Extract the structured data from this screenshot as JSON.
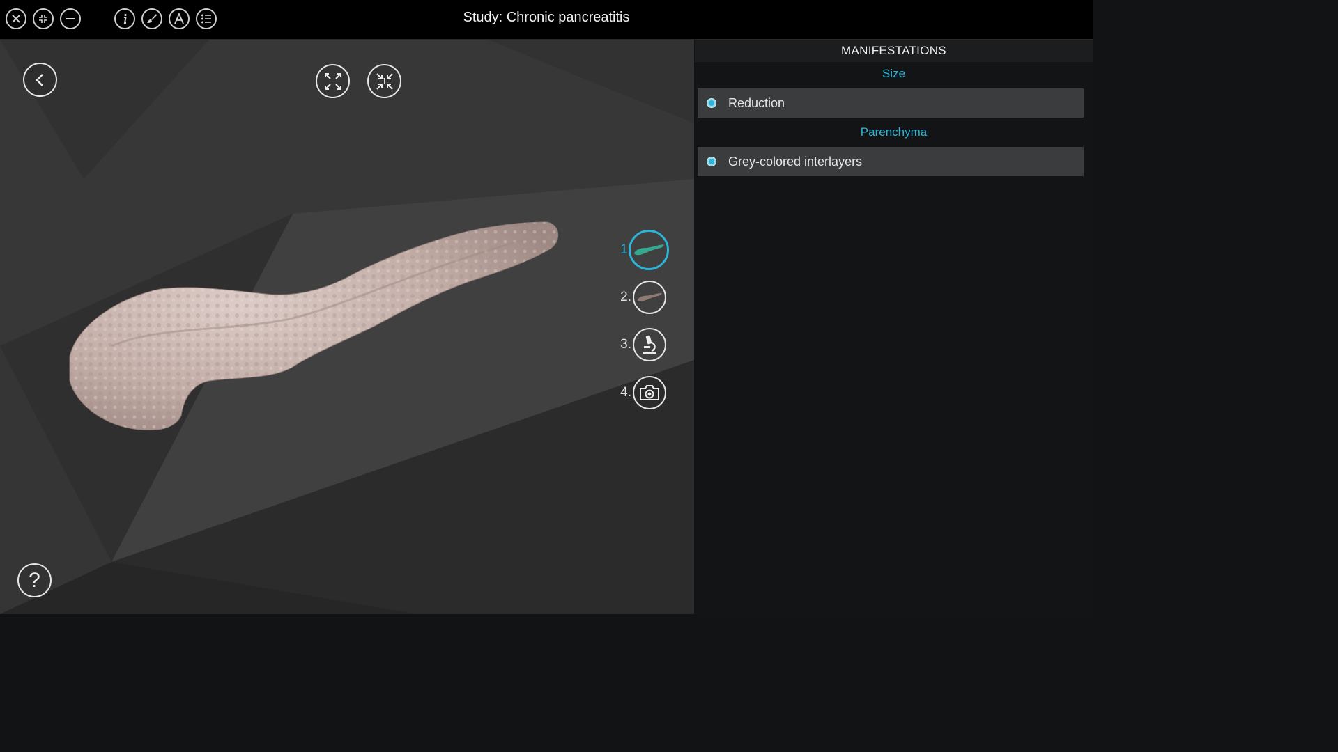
{
  "window": {
    "title": "Study: Chronic pancreatitis"
  },
  "toolbar": {
    "buttons": [
      {
        "name": "close-icon"
      },
      {
        "name": "collapse-icon"
      },
      {
        "name": "minimize-icon"
      },
      {
        "name": "info-icon"
      },
      {
        "name": "paintbrush-icon"
      },
      {
        "name": "font-icon"
      },
      {
        "name": "list-icon"
      }
    ]
  },
  "viewport": {
    "back": "back-arrow-icon",
    "expand": "expand-icon",
    "reset_label": "1",
    "help": "?",
    "steps": [
      {
        "num": "1.",
        "icon": "pancreas-icon",
        "active": true
      },
      {
        "num": "2.",
        "icon": "pancreas-icon",
        "active": false
      },
      {
        "num": "3.",
        "icon": "microscope-icon",
        "active": false
      },
      {
        "num": "4.",
        "icon": "camera-icon",
        "active": false
      }
    ]
  },
  "panel": {
    "header": "MANIFESTATIONS",
    "sections": [
      {
        "title": "Size",
        "items": [
          "Reduction"
        ]
      },
      {
        "title": "Parenchyma",
        "items": [
          "Grey-colored interlayers"
        ]
      }
    ]
  },
  "colors": {
    "accent": "#2db4d8",
    "organ": "#c9b3ae"
  }
}
